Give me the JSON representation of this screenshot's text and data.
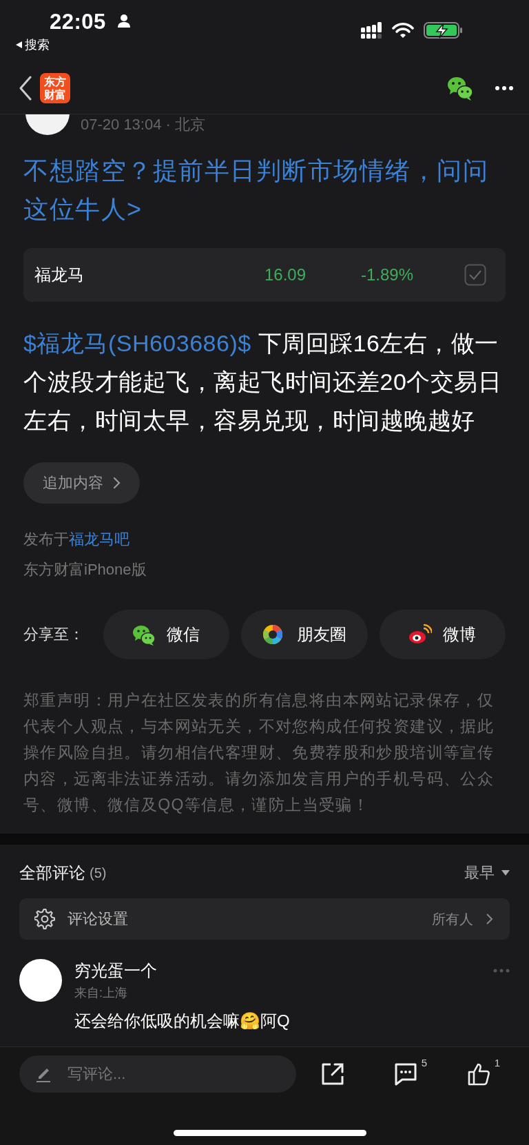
{
  "status_bar": {
    "time": "22:05",
    "back_label": "搜索"
  },
  "nav": {
    "logo_lines": [
      "东方",
      "财富"
    ]
  },
  "post": {
    "meta": "07-20 13:04 · 北京",
    "headline": "不想踏空？提前半日判断市场情绪，问问这位牛人>",
    "stock": {
      "name": "福龙马",
      "price": "16.09",
      "change": "-1.89%",
      "color": "#3fae5c",
      "in_watchlist": true
    },
    "body": {
      "tag": "$福龙马(SH603686)$",
      "text": " 下周回踩16左右，做一个波段才能起飞，离起飞时间还差20个交易日左右，时间太早，容易兑现，时间越晚越好"
    },
    "append_button": "追加内容",
    "published_prefix": "发布于",
    "bar_link": "福龙马吧",
    "client": "东方财富iPhone版"
  },
  "share": {
    "label": "分享至：",
    "targets": [
      {
        "kind": "wechat",
        "label": "微信"
      },
      {
        "kind": "moments",
        "label": "朋友圈"
      },
      {
        "kind": "weibo",
        "label": "微博"
      }
    ]
  },
  "disclaimer": "郑重声明：用户在社区发表的所有信息将由本网站记录保存，仅代表个人观点，与本网站无关，不对您构成任何投资建议，据此操作风险自担。请勿相信代客理财、免费荐股和炒股培训等宣传内容，远离非法证券活动。请勿添加发言用户的手机号码、公众号、微博、微信及QQ等信息，谨防上当受骗！",
  "comments": {
    "title": "全部评论",
    "count": "(5)",
    "sort": "最早",
    "settings": {
      "label": "评论设置",
      "value": "所有人"
    },
    "items": [
      {
        "name": "穷光蛋一个",
        "location": "来自:上海",
        "text": "还会给你低吸的机会嘛🤗阿Q"
      }
    ]
  },
  "bottom_bar": {
    "placeholder": "写评论...",
    "comment_count": "5",
    "like_count": "1"
  }
}
